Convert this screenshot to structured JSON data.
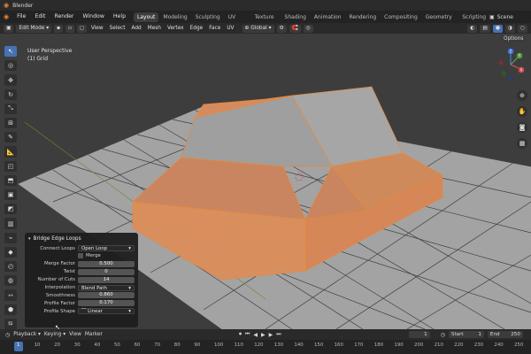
{
  "window": {
    "title": "Blender"
  },
  "menus": [
    "File",
    "Edit",
    "Render",
    "Window",
    "Help"
  ],
  "workspaces": [
    "Layout",
    "Modeling",
    "Sculpting",
    "UV Editing",
    "Texture Paint",
    "Shading",
    "Animation",
    "Rendering",
    "Compositing",
    "Geometry Nodes",
    "Scripting"
  ],
  "active_workspace": "Layout",
  "scene": {
    "name": "Scene"
  },
  "header": {
    "mode": "Edit Mode",
    "menus": [
      "View",
      "Select",
      "Add",
      "Mesh",
      "Vertex",
      "Edge",
      "Face",
      "UV"
    ],
    "transform": "Global",
    "options": "Options"
  },
  "viewport": {
    "info_line1": "User Perspective",
    "info_line2": "(1) Grid"
  },
  "gizmo": {
    "x": "X",
    "y": "Y",
    "z": "Z"
  },
  "operator_panel": {
    "title": "Bridge Edge Loops",
    "connect_loops_label": "Connect Loops",
    "connect_loops_value": "Open Loop",
    "merge_label": "Merge",
    "merge_factor_label": "Merge Factor",
    "merge_factor_value": "0.500",
    "twist_label": "Twist",
    "twist_value": "0",
    "cuts_label": "Number of Cuts",
    "cuts_value": "14",
    "interp_label": "Interpolation",
    "interp_value": "Blend Path",
    "smooth_label": "Smoothness",
    "smooth_value": "0.860",
    "profile_factor_label": "Profile Factor",
    "profile_factor_value": "0.170",
    "profile_shape_label": "Profile Shape",
    "profile_shape_value": "Linear"
  },
  "timeline": {
    "playback": "Playback",
    "keying": "Keying",
    "view": "View",
    "marker": "Marker",
    "current_frame": "1",
    "start_label": "Start",
    "start_value": "1",
    "end_label": "End",
    "end_value": "250"
  },
  "ruler_ticks": [
    "1",
    "10",
    "20",
    "30",
    "40",
    "50",
    "60",
    "70",
    "80",
    "90",
    "100",
    "110",
    "120",
    "130",
    "140",
    "150",
    "160",
    "170",
    "180",
    "190",
    "200",
    "210",
    "220",
    "230",
    "240",
    "250"
  ],
  "colors": {
    "accent": "#4772b3",
    "edge_select": "#e8883a",
    "grid": "#a9a9a9"
  }
}
